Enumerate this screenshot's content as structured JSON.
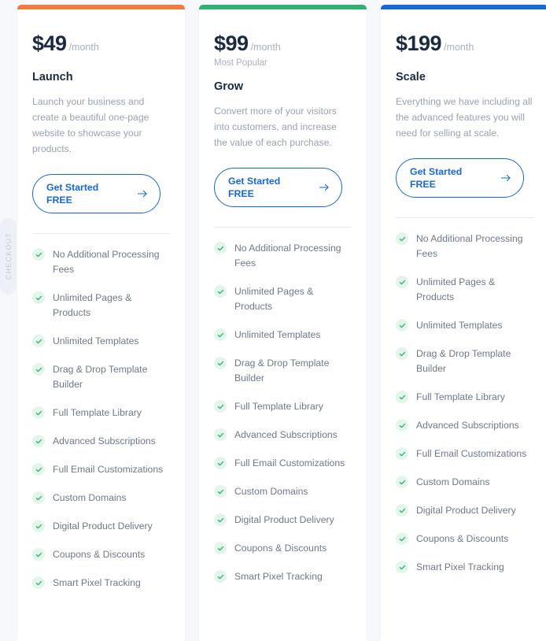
{
  "side_tab": {
    "label": "CHECKOUT"
  },
  "colors": {
    "background": "#f7f8fc",
    "card_background": "#ffffff",
    "accent_launch": "#ef7b3f",
    "accent_grow": "#2fb173",
    "accent_scale": "#1669d4",
    "price_text": "#1b2a41",
    "muted_text": "#a9b0c0",
    "body_text": "#99a1b3",
    "feature_text": "#6f7889",
    "check_circle": "#e4f5ec",
    "check_mark": "#3bb87a",
    "cta_blue": "#1669d4",
    "divider": "#e7e9ef"
  },
  "common": {
    "cta_line1": "Get Started",
    "cta_line2": "FREE",
    "cta_arrow": "arrow-right-icon",
    "check_icon": "check-circle-icon"
  },
  "plans": [
    {
      "id": "launch",
      "accent": "#ef7b3f",
      "price": "$49",
      "period": "/month",
      "note": "",
      "name": "Launch",
      "description": "Launch your business and create a beautiful one-page website to showcase your products.",
      "cta_line1": "Get Started",
      "cta_line2": "FREE",
      "features": [
        "No Additional Processing Fees",
        "Unlimited Pages & Products",
        "Unlimited Templates",
        "Drag & Drop Template Builder",
        "Full Template Library",
        "Advanced Subscriptions",
        "Full Email Customizations",
        "Custom Domains",
        "Digital Product Delivery",
        "Coupons & Discounts",
        "Smart Pixel Tracking"
      ]
    },
    {
      "id": "grow",
      "accent": "#2fb173",
      "price": "$99",
      "period": "/month",
      "note": "Most Popular",
      "name": "Grow",
      "description": "Convert more of your visitors into customers, and increase the value of each purchase.",
      "cta_line1": "Get Started",
      "cta_line2": "FREE",
      "features": [
        "No Additional Processing Fees",
        "Unlimited Pages & Products",
        "Unlimited Templates",
        "Drag & Drop Template Builder",
        "Full Template Library",
        "Advanced Subscriptions",
        "Full Email Customizations",
        "Custom Domains",
        "Digital Product Delivery",
        "Coupons & Discounts",
        "Smart Pixel Tracking"
      ]
    },
    {
      "id": "scale",
      "accent": "#1669d4",
      "price": "$199",
      "period": "/month",
      "note": "",
      "name": "Scale",
      "description": "Everything we have including all the advanced features you will need for selling at scale.",
      "cta_line1": "Get Started",
      "cta_line2": "FREE",
      "features": [
        "No Additional Processing Fees",
        "Unlimited Pages & Products",
        "Unlimited Templates",
        "Drag & Drop Template Builder",
        "Full Template Library",
        "Advanced Subscriptions",
        "Full Email Customizations",
        "Custom Domains",
        "Digital Product Delivery",
        "Coupons & Discounts",
        "Smart Pixel Tracking"
      ]
    }
  ]
}
